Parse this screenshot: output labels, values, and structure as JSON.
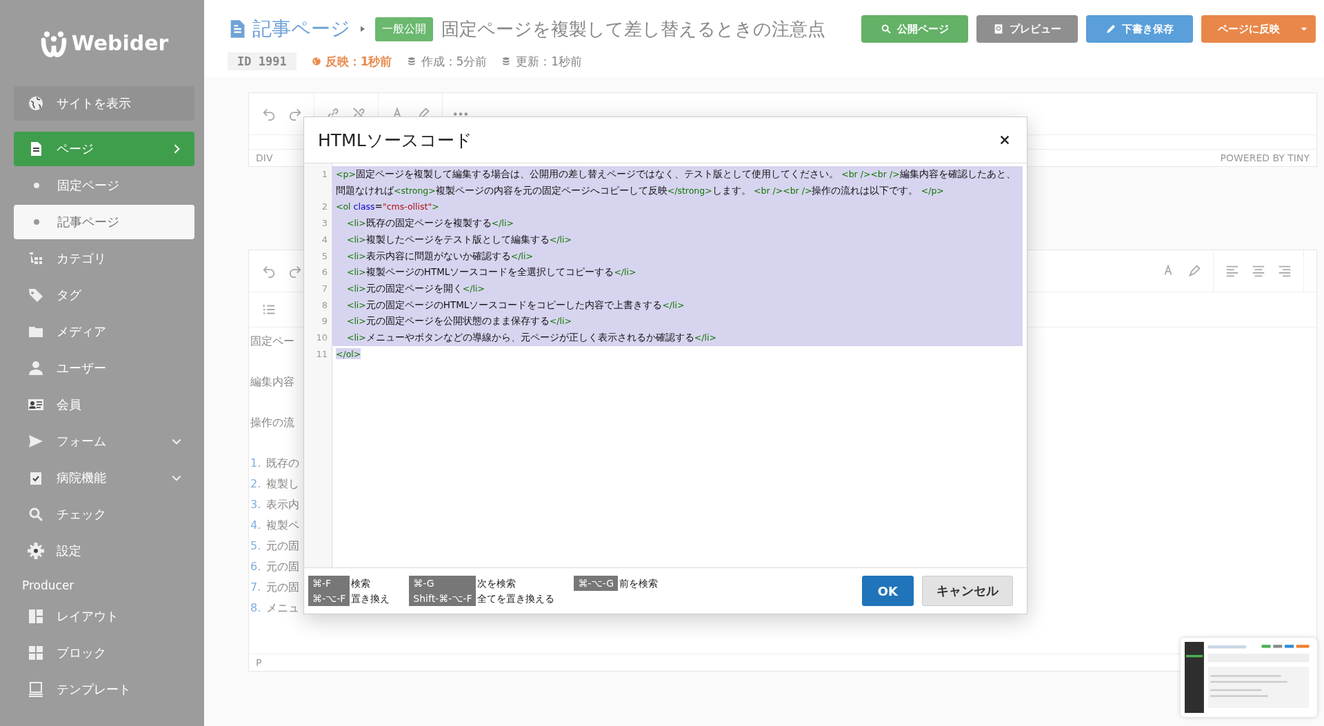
{
  "sidebar": {
    "logo": "Webider",
    "items": [
      {
        "label": "サイトを表示",
        "kind": "link",
        "selected": false
      },
      {
        "label": "ページ",
        "kind": "item",
        "selected": true,
        "expanded": true,
        "children": [
          {
            "label": "固定ページ",
            "selected": false
          },
          {
            "label": "記事ページ",
            "selected": true
          }
        ]
      },
      {
        "label": "カテゴリ",
        "kind": "item",
        "selected": false
      },
      {
        "label": "タグ",
        "kind": "item",
        "selected": false
      },
      {
        "label": "メディア",
        "kind": "item",
        "selected": false
      },
      {
        "label": "ユーザー",
        "kind": "item",
        "selected": false
      },
      {
        "label": "会員",
        "kind": "item",
        "selected": false
      },
      {
        "label": "フォーム",
        "kind": "item",
        "selected": false,
        "expanded": false
      },
      {
        "label": "病院機能",
        "kind": "item",
        "selected": false,
        "expanded": false
      },
      {
        "label": "チェック",
        "kind": "item",
        "selected": false
      },
      {
        "label": "設定",
        "kind": "item",
        "selected": false
      },
      {
        "label": "Producer",
        "kind": "heading"
      },
      {
        "label": "レイアウト",
        "kind": "item",
        "selected": false
      },
      {
        "label": "ブロック",
        "kind": "item",
        "selected": false
      },
      {
        "label": "テンプレート",
        "kind": "item",
        "selected": false
      }
    ]
  },
  "header": {
    "breadcrumb": "記事ページ",
    "status_badge": "一般公開",
    "title": "固定ページを複製して差し替えるときの注意点",
    "buttons": [
      {
        "label": "公開ページ",
        "kind": "public"
      },
      {
        "label": "プレビュー",
        "kind": "preview"
      },
      {
        "label": "下書き保存",
        "kind": "draft"
      },
      {
        "label": "ページに反映",
        "kind": "publish",
        "dropdown": true
      }
    ],
    "meta": {
      "id": "ID 1991",
      "reflected": "反映：1秒前",
      "created": "作成：5分前",
      "updated": "更新：1秒前"
    }
  },
  "editor_top": {
    "status_path": "DIV",
    "powered_by": "POWERED BY TINY"
  },
  "editor_main": {
    "status_path": "P",
    "paragraphs": [
      "固定ペー",
      "編集内容",
      "操作の流"
    ],
    "list": [
      {
        "number": "1.",
        "text": "既存の"
      },
      {
        "number": "2.",
        "text": "複製し"
      },
      {
        "number": "3.",
        "text": "表示内"
      },
      {
        "number": "4.",
        "text": "複製ペ"
      },
      {
        "number": "5.",
        "text": "元の固"
      },
      {
        "number": "6.",
        "text": "元の固"
      },
      {
        "number": "7.",
        "text": "元の固"
      },
      {
        "number": "8.",
        "text": "メニュ"
      }
    ]
  },
  "modal": {
    "title": "HTMLソースコード",
    "lines": [
      {
        "number": "1",
        "selected": true,
        "segments": [
          {
            "kind": "tag",
            "text": "<p>"
          },
          {
            "kind": "text",
            "text": "固定ページを複製して編集する場合は、公開用の差し替えページではなく、テスト版として使用してください。 "
          },
          {
            "kind": "tag",
            "text": "<br /><br />"
          },
          {
            "kind": "text",
            "text": "編集内容を確認したあと、問題なければ"
          },
          {
            "kind": "tag",
            "text": "<strong>"
          },
          {
            "kind": "text",
            "text": "複製ページの内容を元の固定ページへコピーして反映"
          },
          {
            "kind": "tag",
            "text": "</strong>"
          },
          {
            "kind": "text",
            "text": "します。 "
          },
          {
            "kind": "tag",
            "text": "<br /><br />"
          },
          {
            "kind": "text",
            "text": "操作の流れは以下です。 "
          },
          {
            "kind": "tag",
            "text": "</p>"
          }
        ]
      },
      {
        "number": "2",
        "selected": true,
        "segments": [
          {
            "kind": "tag",
            "text": "<ol "
          },
          {
            "kind": "attr",
            "text": "class"
          },
          {
            "kind": "text",
            "text": "="
          },
          {
            "kind": "string",
            "text": "\"cms-ollist\""
          },
          {
            "kind": "tag",
            "text": ">"
          }
        ]
      },
      {
        "number": "3",
        "selected": true,
        "segments": [
          {
            "kind": "tag",
            "text": "    <li>"
          },
          {
            "kind": "text",
            "text": "既存の固定ページを複製する"
          },
          {
            "kind": "tag",
            "text": "</li>"
          }
        ]
      },
      {
        "number": "4",
        "selected": true,
        "segments": [
          {
            "kind": "tag",
            "text": "    <li>"
          },
          {
            "kind": "text",
            "text": "複製したページをテスト版として編集する"
          },
          {
            "kind": "tag",
            "text": "</li>"
          }
        ]
      },
      {
        "number": "5",
        "selected": true,
        "segments": [
          {
            "kind": "tag",
            "text": "    <li>"
          },
          {
            "kind": "text",
            "text": "表示内容に問題がないか確認する"
          },
          {
            "kind": "tag",
            "text": "</li>"
          }
        ]
      },
      {
        "number": "6",
        "selected": true,
        "segments": [
          {
            "kind": "tag",
            "text": "    <li>"
          },
          {
            "kind": "text",
            "text": "複製ページのHTMLソースコードを全選択してコピーする"
          },
          {
            "kind": "tag",
            "text": "</li>"
          }
        ]
      },
      {
        "number": "7",
        "selected": true,
        "segments": [
          {
            "kind": "tag",
            "text": "    <li>"
          },
          {
            "kind": "text",
            "text": "元の固定ページを開く"
          },
          {
            "kind": "tag",
            "text": "</li>"
          }
        ]
      },
      {
        "number": "8",
        "selected": true,
        "segments": [
          {
            "kind": "tag",
            "text": "    <li>"
          },
          {
            "kind": "text",
            "text": "元の固定ページのHTMLソースコードをコピーした内容で上書きする"
          },
          {
            "kind": "tag",
            "text": "</li>"
          }
        ]
      },
      {
        "number": "9",
        "selected": true,
        "segments": [
          {
            "kind": "tag",
            "text": "    <li>"
          },
          {
            "kind": "text",
            "text": "元の固定ページを公開状態のまま保存する"
          },
          {
            "kind": "tag",
            "text": "</li>"
          }
        ]
      },
      {
        "number": "10",
        "selected": true,
        "segments": [
          {
            "kind": "tag",
            "text": "    <li>"
          },
          {
            "kind": "text",
            "text": "メニューやボタンなどの導線から、元ページが正しく表示されるか確認する"
          },
          {
            "kind": "tag",
            "text": "</li>"
          }
        ]
      },
      {
        "number": "11",
        "selected": true,
        "segments": [
          {
            "kind": "tag",
            "text": "</ol>"
          }
        ]
      }
    ],
    "shortcuts": [
      [
        {
          "keys": "⌘-F",
          "action": "検索"
        },
        {
          "keys": "⌘-⌥-F",
          "action": "置き換え"
        }
      ],
      [
        {
          "keys": "⌘-G",
          "action": "次を検索"
        },
        {
          "keys": "Shift-⌘-⌥-F",
          "action": "全てを置き換える"
        }
      ],
      [
        {
          "keys": "⌘-⌥-G",
          "action": "前を検索"
        }
      ]
    ],
    "buttons": [
      {
        "label": "OK",
        "kind": "primary"
      },
      {
        "label": "キャンセル",
        "kind": "secondary"
      }
    ]
  }
}
